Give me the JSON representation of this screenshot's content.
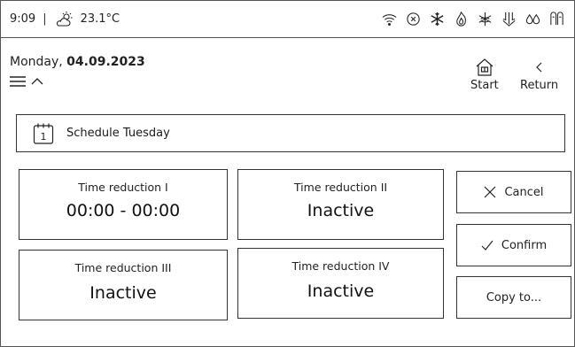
{
  "status": {
    "time": "9:09",
    "separator": "|",
    "temperature": "23.1°C",
    "icons": [
      "weather-sun-cloud-icon",
      "wifi-icon",
      "circle-x-icon",
      "snowflake-icon",
      "flame-icon",
      "defrost-icon",
      "arrows-down-icon",
      "water-drops-icon",
      "hot-water-icon"
    ]
  },
  "header": {
    "day": "Monday, ",
    "date": "04.09.2023",
    "start_label": "Start",
    "return_label": "Return"
  },
  "schedule": {
    "calendar_day": "1",
    "title": "Schedule Tuesday"
  },
  "tiles": [
    {
      "label": "Time reduction I",
      "value": "00:00 - 00:00"
    },
    {
      "label": "Time reduction II",
      "value": "Inactive"
    },
    {
      "label": "Time reduction III",
      "value": "Inactive"
    },
    {
      "label": "Time reduction IV",
      "value": "Inactive"
    }
  ],
  "actions": {
    "cancel": "Cancel",
    "confirm": "Confirm",
    "copy": "Copy to..."
  }
}
